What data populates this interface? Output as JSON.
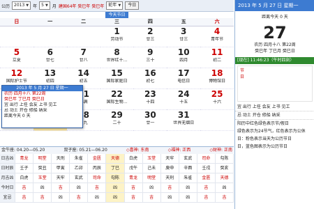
{
  "toolbar": {
    "label_gongyuan": "公历",
    "year": "2013",
    "label_year": "年",
    "month": "5",
    "label_month": "月",
    "ganzhi": "建国64年 癸巳年 癸巳年",
    "zodiac": "蛇年",
    "today_btn": "今日"
  },
  "festival_tag": "今天节日",
  "weekdays": [
    "日",
    "一",
    "二",
    "三",
    "四",
    "五",
    "六"
  ],
  "days": [
    {
      "n": "",
      "s": ""
    },
    {
      "n": "",
      "s": ""
    },
    {
      "n": "",
      "s": ""
    },
    {
      "n": "1",
      "s": "劳动节"
    },
    {
      "n": "2",
      "s": "廿三"
    },
    {
      "n": "3",
      "s": "廿三"
    },
    {
      "n": "4",
      "s": "青年节"
    },
    {
      "n": "5",
      "s": "立夏"
    },
    {
      "n": "6",
      "s": "廿七"
    },
    {
      "n": "7",
      "s": "廿八"
    },
    {
      "n": "8",
      "s": "世界红十..."
    },
    {
      "n": "9",
      "s": "三十"
    },
    {
      "n": "10",
      "s": "四月"
    },
    {
      "n": "11",
      "s": "初二"
    },
    {
      "n": "12",
      "s": "国际护士节"
    },
    {
      "n": "13",
      "s": "初四"
    },
    {
      "n": "14",
      "s": "初五"
    },
    {
      "n": "15",
      "s": "国际家庭日"
    },
    {
      "n": "16",
      "s": "初七"
    },
    {
      "n": "17",
      "s": "电信日"
    },
    {
      "n": "18",
      "s": "博物馆日"
    },
    {
      "n": "19",
      "s": "初十"
    },
    {
      "n": "20",
      "s": "学生营养日"
    },
    {
      "n": "21",
      "s": "小满"
    },
    {
      "n": "22",
      "s": "国际生物..."
    },
    {
      "n": "23",
      "s": "十四"
    },
    {
      "n": "24",
      "s": "十五"
    },
    {
      "n": "25",
      "s": "十六"
    },
    {
      "n": "26",
      "s": "十七"
    },
    {
      "n": "27",
      "s": "十八"
    },
    {
      "n": "28",
      "s": "十九"
    },
    {
      "n": "29",
      "s": "二十"
    },
    {
      "n": "30",
      "s": "廿一"
    },
    {
      "n": "31",
      "s": "世界无烟日"
    },
    {
      "n": "",
      "s": ""
    }
  ],
  "popup": {
    "title": "2013 年 5 月 27 日 星期一",
    "lunar": "农历 四月十八 第22周",
    "ganzhi": "癸巳年 丁巳月 癸巳日",
    "yi": "宜 出行 上任 会友 上书 见工",
    "ji": "忌 动土 开仓 修船 纳采",
    "countdown": "距离今天 0 天"
  },
  "bottom": {
    "info_left": "金牛座: 04.20—05.20",
    "info_mid": "双子座: 05.21—06.20",
    "xi": "◇喜神: 东南",
    "fu": "◇福神: 正西",
    "cai": "◇财神: 正南",
    "rows": [
      [
        "日吉凶",
        "青龙",
        "明堂",
        "天刑",
        "朱雀",
        "金匮",
        "天德",
        "白虎",
        "玉堂",
        "天牢",
        "玄武",
        "司命",
        "勾陈"
      ],
      [
        "日时辰",
        "壬子",
        "癸丑",
        "甲寅",
        "乙卯",
        "丙辰",
        "丁巳",
        "戊午",
        "己未",
        "庚申",
        "辛酉",
        "壬戌",
        "癸亥"
      ],
      [
        "月吉凶",
        "白虎",
        "玉堂",
        "天牢",
        "玄武",
        "司命",
        "勾陈",
        "青龙",
        "明堂",
        "天刑",
        "朱雀",
        "金匮",
        "天德"
      ],
      [
        "今时日",
        "吉",
        "凶",
        "吉",
        "凶",
        "吉",
        "凶",
        "吉",
        "凶",
        "吉",
        "凶",
        "吉",
        "凶"
      ],
      [
        "宜忌",
        "吉",
        "吉",
        "凶",
        "吉",
        "凶",
        "凶",
        "吉",
        "吉",
        "凶",
        "凶",
        "吉",
        "吉"
      ]
    ]
  },
  "right": {
    "date_title": "2013 年 5 月 27 日 星期一",
    "distance": "距离今天 0 天",
    "day": "27",
    "lunar": "农历 四月十八 第22周",
    "ganzhi": "癸巳年 丁巳月 癸巳日",
    "now_label": "[现在]",
    "now_time": "11:46:23（午时四刻）",
    "jie_label": "节日",
    "yi": "宜 出行 上任 会友 上书 见工",
    "ji": "忌 动土 开仓 修船 纳采",
    "line1": "阳历中红色绿色表示节/假日",
    "line2": "绿色表示为24节气，红色表示为公休",
    "line3": "日：粉色表示当天为公历节日",
    "line4": "日，蓝色图表示为公历节日"
  }
}
